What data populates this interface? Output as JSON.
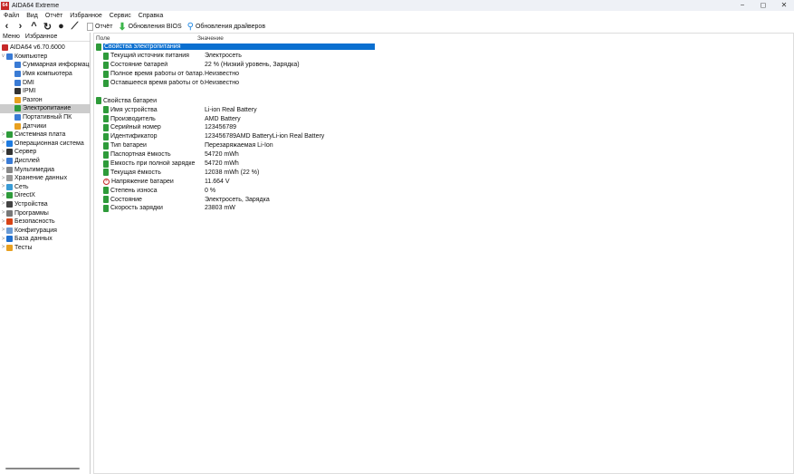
{
  "window": {
    "title": "AIDA64 Extreme",
    "icon_text": "64",
    "min": "−",
    "max": "◻",
    "close": "✕"
  },
  "menu": [
    "Файл",
    "Вид",
    "Отчёт",
    "Избранное",
    "Сервис",
    "Справка"
  ],
  "toolbar": {
    "report": "Отчёт",
    "bios": "Обновления BIOS",
    "drivers": "Обновления драйверов"
  },
  "left_tabs": [
    "Меню",
    "Избранное"
  ],
  "tree": [
    {
      "label": "AIDA64 v6.70.6000",
      "level": 0,
      "color": "#c62828"
    },
    {
      "label": "Компьютер",
      "level": 0,
      "exp": "v",
      "color": "#3a7bd5"
    },
    {
      "label": "Суммарная информация",
      "level": 1,
      "color": "#3a7bd5"
    },
    {
      "label": "Имя компьютера",
      "level": 1,
      "color": "#3a7bd5"
    },
    {
      "label": "DMI",
      "level": 1,
      "color": "#3a7bd5"
    },
    {
      "label": "IPMI",
      "level": 1,
      "color": "#333"
    },
    {
      "label": "Разгон",
      "level": 1,
      "color": "#e8a020"
    },
    {
      "label": "Электропитание",
      "level": 1,
      "color": "#2e9b3a",
      "selected": true
    },
    {
      "label": "Портативный ПК",
      "level": 1,
      "color": "#3a7bd5"
    },
    {
      "label": "Датчики",
      "level": 1,
      "color": "#e8a020"
    },
    {
      "label": "Системная плата",
      "level": 0,
      "exp": ">",
      "color": "#2e9b3a"
    },
    {
      "label": "Операционная система",
      "level": 0,
      "exp": ">",
      "color": "#1e7be0"
    },
    {
      "label": "Сервер",
      "level": 0,
      "exp": ">",
      "color": "#333"
    },
    {
      "label": "Дисплей",
      "level": 0,
      "exp": ">",
      "color": "#3a7bd5"
    },
    {
      "label": "Мультимедиа",
      "level": 0,
      "exp": ">",
      "color": "#888"
    },
    {
      "label": "Хранение данных",
      "level": 0,
      "exp": ">",
      "color": "#999"
    },
    {
      "label": "Сеть",
      "level": 0,
      "exp": ">",
      "color": "#3a9bd5"
    },
    {
      "label": "DirectX",
      "level": 0,
      "exp": ">",
      "color": "#2e9b3a"
    },
    {
      "label": "Устройства",
      "level": 0,
      "exp": ">",
      "color": "#444"
    },
    {
      "label": "Программы",
      "level": 0,
      "exp": ">",
      "color": "#777"
    },
    {
      "label": "Безопасность",
      "level": 0,
      "exp": ">",
      "color": "#d84315"
    },
    {
      "label": "Конфигурация",
      "level": 0,
      "exp": ">",
      "color": "#6a9bd5"
    },
    {
      "label": "База данных",
      "level": 0,
      "exp": ">",
      "color": "#1e6fd0"
    },
    {
      "label": "Тесты",
      "level": 0,
      "exp": ">",
      "color": "#e8a020"
    }
  ],
  "columns": {
    "field": "Поле",
    "value": "Значение"
  },
  "sections": [
    {
      "title": "Свойства электропитания",
      "selected": true,
      "rows": [
        {
          "f": "Текущий источник питания",
          "v": "Электросеть"
        },
        {
          "f": "Состояние батарей",
          "v": "22 % (Низкий уровень, Зарядка)"
        },
        {
          "f": "Полное время работы от батар...",
          "v": "Неизвестно"
        },
        {
          "f": "Оставшееся время работы от б...",
          "v": "Неизвестно"
        }
      ]
    },
    {
      "title": "Свойства батареи",
      "rows": [
        {
          "f": "Имя устройства",
          "v": "Li-ion Real Battery"
        },
        {
          "f": "Производитель",
          "v": "AMD Battery"
        },
        {
          "f": "Серийный номер",
          "v": "123456789"
        },
        {
          "f": "Идентификатор",
          "v": "123456789AMD BatteryLi-ion Real Battery"
        },
        {
          "f": "Тип батареи",
          "v": "Перезаряжаемая Li-Ion"
        },
        {
          "f": "Паспортная ёмкость",
          "v": "54720 mWh"
        },
        {
          "f": "Ёмкость при полной зарядке",
          "v": "54720 mWh"
        },
        {
          "f": "Текущая ёмкость",
          "v": "12038 mWh  (22 %)"
        },
        {
          "f": "Напряжение батареи",
          "v": "11.664 V",
          "icon": "warn"
        },
        {
          "f": "Степень износа",
          "v": "0 %"
        },
        {
          "f": "Состояние",
          "v": "Электросеть, Зарядка"
        },
        {
          "f": "Скорость зарядки",
          "v": "23803 mW"
        }
      ]
    }
  ]
}
